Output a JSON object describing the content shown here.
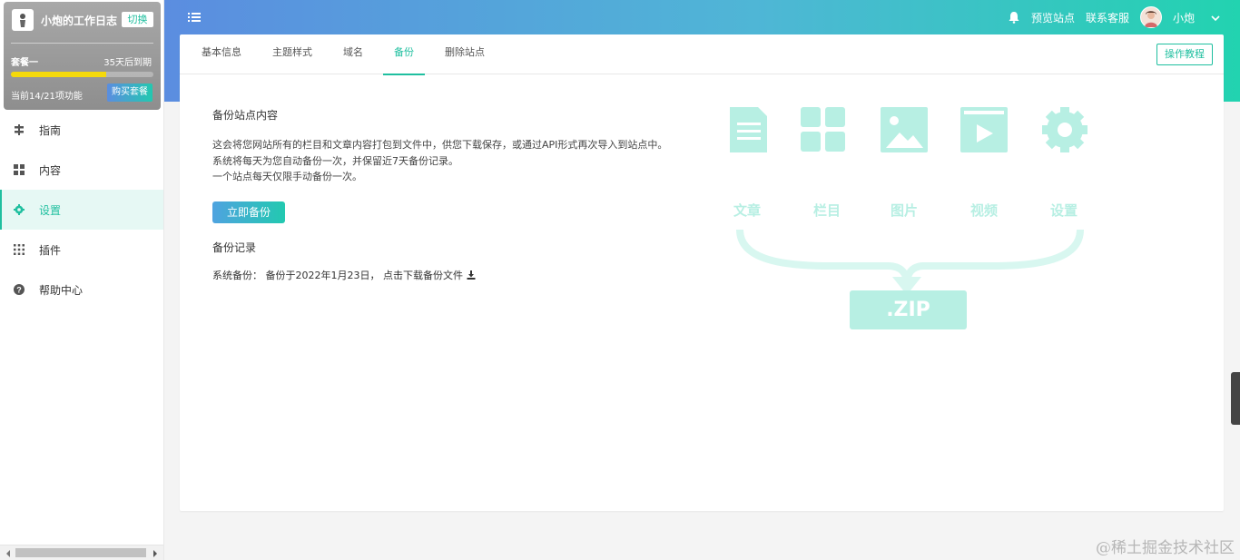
{
  "header": {
    "preview_label": "预览站点",
    "support_label": "联系客服",
    "user_name": "小炮",
    "icons": [
      "menu-icon",
      "bell-icon",
      "chevron-down-icon"
    ]
  },
  "site_card": {
    "name": "小炮的工作日志",
    "switch_label": "切换",
    "plan_name": "套餐一",
    "expire_text": "35天后到期",
    "progress": 0.67,
    "features_text": "当前14/21项功能",
    "buy_label": "购买套餐"
  },
  "sidebar": {
    "items": [
      {
        "label": "指南",
        "icon": "guide-icon",
        "active": false
      },
      {
        "label": "内容",
        "icon": "grid-icon",
        "active": false
      },
      {
        "label": "设置",
        "icon": "gear-icon",
        "active": true
      },
      {
        "label": "插件",
        "icon": "apps-icon",
        "active": false
      },
      {
        "label": "帮助中心",
        "icon": "help-icon",
        "active": false
      }
    ]
  },
  "tabs": {
    "items": [
      "基本信息",
      "主题样式",
      "域名",
      "备份",
      "删除站点"
    ],
    "active": "备份",
    "tutorial_label": "操作教程"
  },
  "backup": {
    "title": "备份站点内容",
    "desc_1": "这会将您网站所有的栏目和文章内容打包到文件中，供您下载保存，或通过API形式再次导入到站点中。",
    "desc_2": "系统将每天为您自动备份一次，并保留近7天备份记录。",
    "desc_3": "一个站点每天仅限手动备份一次。",
    "button_label": "立即备份",
    "records_title": "备份记录",
    "record_text": "系统备份：  备份于2022年1月23日，  点击下载备份文件"
  },
  "illustration": {
    "labels": [
      "文章",
      "栏目",
      "图片",
      "视频",
      "设置"
    ],
    "zip_label": ".ZIP",
    "color": "#b7efe3"
  },
  "watermark": "@稀土掘金技术社区",
  "colors": {
    "accent": "#1fbf9f",
    "progress": "#f5d90a"
  }
}
